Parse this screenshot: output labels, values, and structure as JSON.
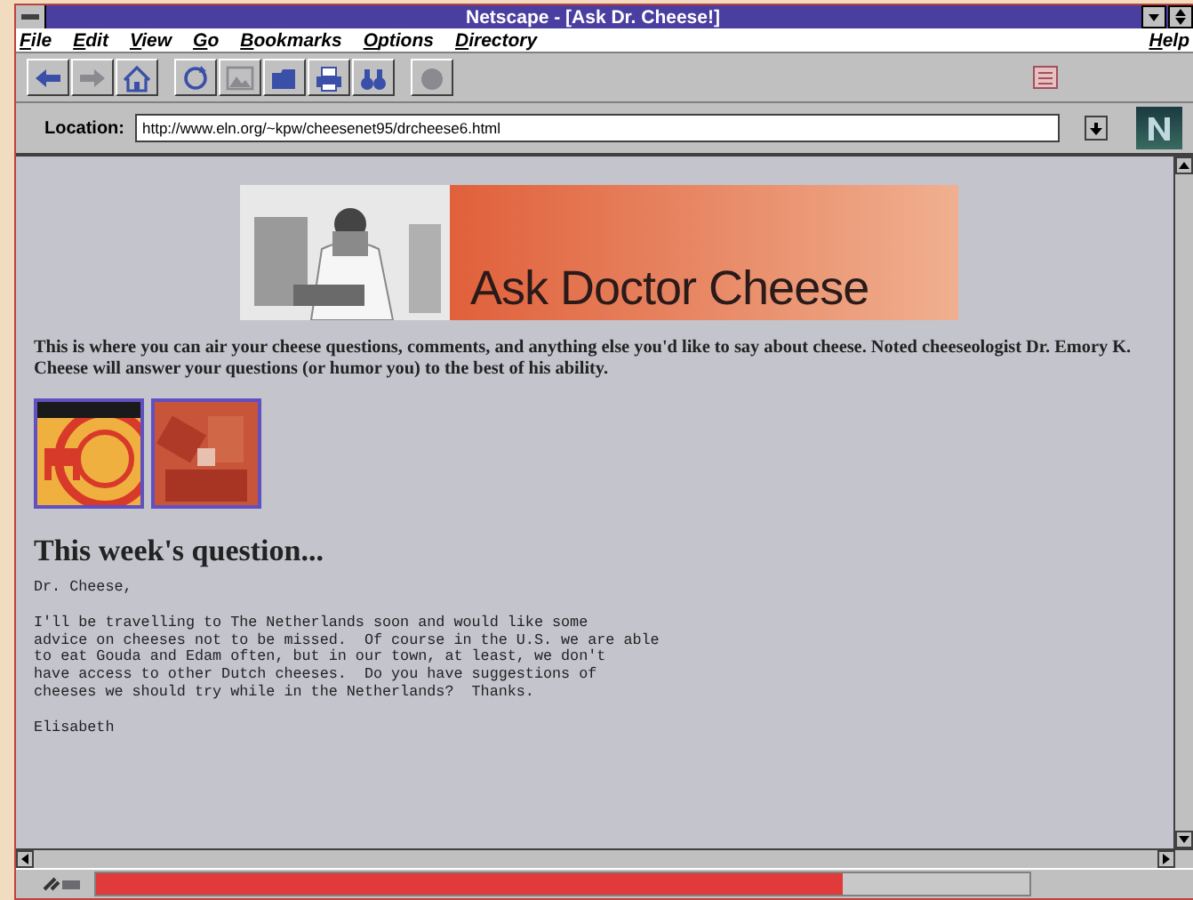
{
  "window": {
    "title": "Netscape - [Ask Dr. Cheese!]"
  },
  "menu": [
    {
      "label": "File"
    },
    {
      "label": "Edit"
    },
    {
      "label": "View"
    },
    {
      "label": "Go"
    },
    {
      "label": "Bookmarks"
    },
    {
      "label": "Options"
    },
    {
      "label": "Directory"
    }
  ],
  "help_menu": {
    "label": "Help"
  },
  "toolbar": [
    [
      {
        "kind": "back",
        "disabled": false
      },
      {
        "kind": "forward",
        "disabled": true
      },
      {
        "kind": "home",
        "disabled": false
      }
    ],
    [
      {
        "kind": "reload",
        "disabled": false
      },
      {
        "kind": "images",
        "disabled": true
      },
      {
        "kind": "open",
        "disabled": false
      },
      {
        "kind": "print",
        "disabled": false
      },
      {
        "kind": "find",
        "disabled": false
      }
    ],
    [
      {
        "kind": "stop",
        "disabled": true
      }
    ]
  ],
  "location": {
    "label": "Location:",
    "value": "http://www.eln.org/~kpw/cheesenet95/drcheese6.html"
  },
  "page": {
    "banner_title": "Ask Doctor Cheese",
    "intro": "This is where you can air your cheese questions, comments, and anything else you'd like to say about cheese. Noted cheeseologist Dr. Emory K. Cheese will answer your questions (or humor you) to the best of his ability.",
    "heading": "This week's question...",
    "letter": [
      "Dr. Cheese,",
      "I'll be travelling to The Netherlands soon and would like some\nadvice on cheeses not to be missed.  Of course in the U.S. we are able\nto eat Gouda and Edam often, but in our town, at least, we don't\nhave access to other Dutch cheeses.  Do you have suggestions of\ncheeses we should try while in the Netherlands?  Thanks.",
      "Elisabeth"
    ]
  },
  "status_bar": {
    "progress": {
      "level": 0.8
    }
  }
}
